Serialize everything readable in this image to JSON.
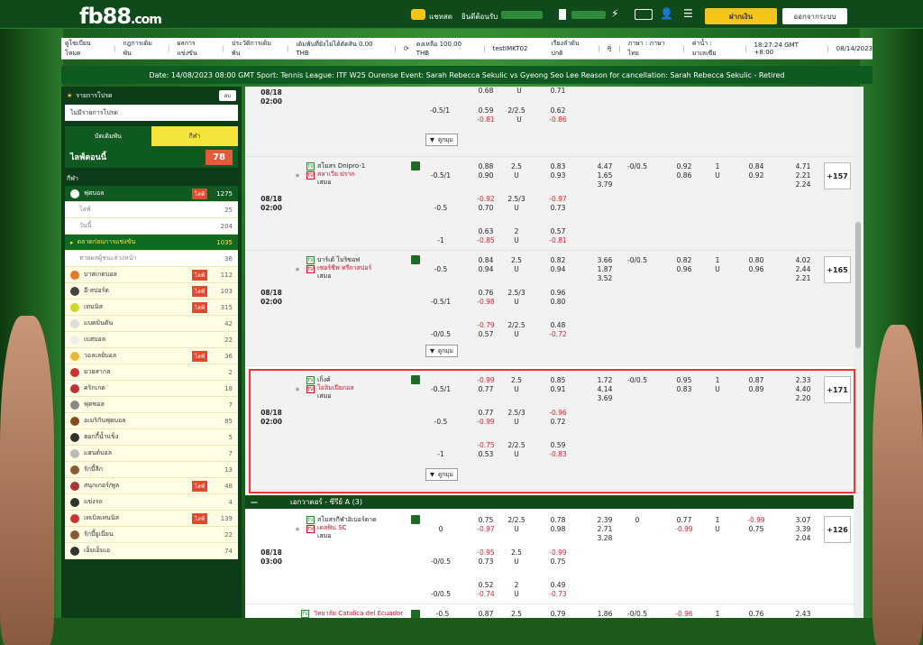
{
  "topbar": {
    "logo": "fb88",
    "logo_suffix": ".com",
    "chat": "แชทสด",
    "welcome": "ยินดีต้อนรับ",
    "deposit": "ฝากเงิน",
    "logout": "ออกจากระบบ"
  },
  "nav": {
    "items": [
      "ดูโซเบี่ยนโหมด",
      "กฎการเดิมพัน",
      "ผลการแข่งขัน",
      "ประวัติการเดิมพัน",
      "เดิมพันที่ยังไม่ได้ตัดสิน 0.00 THB",
      "คงเหลือ 100.00 THB",
      "testIMKT02",
      "เรียงลำดับปกติ",
      "คู่",
      "ภาษา : ภาษาไทย",
      "ค่าน้ำ : มาเลเซีย",
      "18:27:24 GMT +8:00",
      "08/14/2023"
    ]
  },
  "ticker": "Date: 14/08/2023 08:00 GMT Sport: Tennis League: ITF W25 Ourense Event: Sarah Rebecca Sekulic vs Gyeong Seo Lee Reason for cancellation: Sarah Rebecca Sekulic - Retired",
  "sidebar": {
    "fav_title": "รายการโปรด",
    "fav_btn": "ลบ",
    "no_fav": "ไม่มีรายการโปรด",
    "tab_bet": "บัตเดิมพัน",
    "tab_sport": "กีฬา",
    "live_now": "ไลฟ์ตอนนี้",
    "live_count": "78",
    "sports_head": "กีฬา",
    "football": {
      "label": "ฟุตบอล",
      "live": "ไลฟ์",
      "count": "1275"
    },
    "subs": [
      {
        "label": "ไลฟ์",
        "count": "25"
      },
      {
        "label": "วันนี้",
        "count": "204"
      }
    ],
    "early": {
      "label": "ตลาดก่อนการแข่งขัน",
      "count": "1035"
    },
    "outright": {
      "label": "ทายผลผู้ชนะล่วงหน้า",
      "count": "36"
    },
    "sports": [
      {
        "label": "บาสเกตบอล",
        "live": "ไลฟ์",
        "count": "112",
        "color": "#e07a28"
      },
      {
        "label": "อี-สปอร์ต",
        "live": "ไลฟ์",
        "count": "103",
        "color": "#444"
      },
      {
        "label": "เทนนิส",
        "live": "ไลฟ์",
        "count": "315",
        "color": "#cdd62a"
      },
      {
        "label": "แบดมินตัน",
        "live": "",
        "count": "42",
        "color": "#ddd"
      },
      {
        "label": "เบสบอล",
        "live": "",
        "count": "22",
        "color": "#eee"
      },
      {
        "label": "วอลเลย์บอล",
        "live": "ไลฟ์",
        "count": "36",
        "color": "#e7b93a"
      },
      {
        "label": "มวยสากล",
        "live": "",
        "count": "2",
        "color": "#c33"
      },
      {
        "label": "คริกเกต",
        "live": "",
        "count": "18",
        "color": "#b33"
      },
      {
        "label": "ฟุตซอล",
        "live": "",
        "count": "7",
        "color": "#888"
      },
      {
        "label": "อเมริกันฟุตบอล",
        "live": "",
        "count": "85",
        "color": "#8a4a20"
      },
      {
        "label": "ฮอกกี้น้ำแข็ง",
        "live": "",
        "count": "5",
        "color": "#333"
      },
      {
        "label": "แฮนด์บอล",
        "live": "",
        "count": "7",
        "color": "#bbb"
      },
      {
        "label": "รักบี้ลีก",
        "live": "",
        "count": "13",
        "color": "#8a5a30"
      },
      {
        "label": "สนุกเกอร์/พูล",
        "live": "ไลฟ์",
        "count": "48",
        "color": "#a33"
      },
      {
        "label": "แข่งรถ",
        "live": "",
        "count": "4",
        "color": "#333"
      },
      {
        "label": "เทเบิลเทนนิส",
        "live": "ไลฟ์",
        "count": "139",
        "color": "#c33"
      },
      {
        "label": "รักบี้ยูเนี่ยน",
        "live": "",
        "count": "22",
        "color": "#8a5a30"
      },
      {
        "label": "เอ็มเอ็มเอ",
        "live": "",
        "count": "74",
        "color": "#333"
      }
    ]
  },
  "matches": {
    "expand_label": "ดูกมุม",
    "m0": {
      "date": "08/18",
      "time": "02:00",
      "rows": [
        {
          "hdp": "",
          "hv": "0.68",
          "ou": "",
          "ouv": "0.71",
          "u": "U"
        },
        {
          "hdp": "-0.5/1",
          "hv1": "0.59",
          "hv2": "-0.81",
          "ou": "2/2.5",
          "ouv1": "0.62",
          "ouv2": "-0.86",
          "u": "U"
        }
      ]
    },
    "m1": {
      "home": "สโมสร Dnipro-1",
      "away": "สลาเวีย ปราก",
      "draw": "เสมอ",
      "date": "08/18",
      "time": "02:00",
      "more": "+157",
      "rows": [
        {
          "hdp": "-0.5/1",
          "h": [
            "0.88",
            "0.90"
          ],
          "ou": "2.5",
          "o": [
            "0.83",
            "0.93"
          ],
          "x": [
            "4.47",
            "1.65",
            "3.79"
          ],
          "hdp2": "-0/0.5",
          "h2": [
            "0.92",
            "0.86"
          ],
          "ou2": "1",
          "o2": [
            "0.84",
            "0.92"
          ],
          "x2": [
            "4.71",
            "2.21",
            "2.24"
          ]
        },
        {
          "hdp": "-0.5",
          "h": [
            "-0.92",
            "0.70"
          ],
          "ou": "2.5/3",
          "o": [
            "-0.97",
            "0.73"
          ]
        },
        {
          "hdp": "-1",
          "h": [
            "0.63",
            "-0.85"
          ],
          "ou": "2",
          "o": [
            "0.57",
            "-0.81"
          ]
        }
      ]
    },
    "m2": {
      "home": "บาร์เต้ โบริซอฟ",
      "away": "เซอร์ซีฟ ทรีกาสปอร์",
      "draw": "เสมอ",
      "date": "08/18",
      "time": "02:00",
      "more": "+165",
      "rows": [
        {
          "hdp": "-0.5",
          "h": [
            "0.84",
            "0.94"
          ],
          "ou": "2.5",
          "o": [
            "0.82",
            "0.94"
          ],
          "x": [
            "3.66",
            "1.87",
            "3.52"
          ],
          "hdp2": "-0/0.5",
          "h2": [
            "0.82",
            "0.96"
          ],
          "ou2": "1",
          "o2": [
            "0.80",
            "0.96"
          ],
          "x2": [
            "4.02",
            "2.44",
            "2.21"
          ]
        },
        {
          "hdp": "-0.5/1",
          "h": [
            "0.76",
            "-0.98"
          ],
          "ou": "2.5/3",
          "o": [
            "0.96",
            "0.80"
          ]
        },
        {
          "hdp": "-0/0.5",
          "h": [
            "-0.79",
            "0.57"
          ],
          "ou": "2/2.5",
          "o": [
            "0.48",
            "-0.72"
          ]
        }
      ]
    },
    "m3": {
      "home": "เก็งค์",
      "away": "โอลิมเปียกอส",
      "draw": "เสมอ",
      "date": "08/18",
      "time": "02:00",
      "more": "+171",
      "rows": [
        {
          "hdp": "-0.5/1",
          "h": [
            "-0.99",
            "0.77"
          ],
          "ou": "2.5",
          "o": [
            "0.85",
            "0.91"
          ],
          "x": [
            "1.72",
            "4.14",
            "3.69"
          ],
          "hdp2": "-0/0.5",
          "h2": [
            "0.95",
            "0.83"
          ],
          "ou2": "1",
          "o2": [
            "0.87",
            "0.89"
          ],
          "x2": [
            "2.33",
            "4.40",
            "2.20"
          ]
        },
        {
          "hdp": "-0.5",
          "h": [
            "0.77",
            "-0.99"
          ],
          "ou": "2.5/3",
          "o": [
            "-0.96",
            "0.72"
          ]
        },
        {
          "hdp": "-1",
          "h": [
            "-0.75",
            "0.53"
          ],
          "ou": "2/2.5",
          "o": [
            "0.59",
            "-0.83"
          ]
        }
      ]
    },
    "league2": "เอกวาดอร์ - ซีรีย์ A (3)",
    "m4": {
      "home": "สโมสรกีฬาอิเบอร์ดาด",
      "away": "เดลฟิน SC",
      "draw": "เสมอ",
      "date": "08/18",
      "time": "03:00",
      "more": "+126",
      "rows": [
        {
          "hdp": "0",
          "h": [
            "0.75",
            "-0.97"
          ],
          "ou": "2/2.5",
          "o": [
            "0.78",
            "0.98"
          ],
          "x": [
            "2.39",
            "2.71",
            "3.28"
          ],
          "hdp2": "0",
          "h2": [
            "0.77",
            "-0.99"
          ],
          "ou2": "1",
          "o2": [
            "-0.99",
            "0.75"
          ],
          "x2": [
            "3.07",
            "3.39",
            "2.04"
          ]
        },
        {
          "hdp": "-0/0.5",
          "h": [
            "-0.95",
            "0.73"
          ],
          "ou": "2.5",
          "o": [
            "-0.99",
            "0.75"
          ]
        },
        {
          "hdp": "-0/0.5",
          "h": [
            "0.52",
            "-0.74"
          ],
          "ou": "2",
          "o": [
            "0.49",
            "-0.73"
          ]
        }
      ]
    },
    "m5": {
      "home": "วิทยาลัย Catolica del Ecuador",
      "hdp": "-0.5",
      "h": "0.87",
      "ou": "2.5",
      "o": "0.79",
      "x": "1.86",
      "hdp2": "-0/0.5",
      "h2": "-0.96",
      "ou2": "1",
      "o2": "0.76",
      "x2": "2.43"
    }
  },
  "colors": {
    "accent": "#0f4a1a",
    "odds_negative": "#d22233",
    "highlight": "#e33333",
    "live_badge": "#e04a2e",
    "deposit": "#f5c518"
  }
}
